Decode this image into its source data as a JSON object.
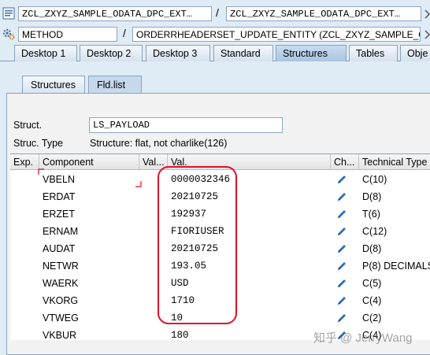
{
  "header": {
    "object_left": "ZCL_ZXYZ_SAMPLE_ODATA_DPC_EXT…",
    "object_right": "ZCL_ZXYZ_SAMPLE_ODATA_DPC_EXT…",
    "type": "METHOD",
    "method": "ORDERRHEADERSET_UPDATE_ENTITY (ZCL_ZXYZ_SAMPLE_O…",
    "separator": "/"
  },
  "tabs": [
    {
      "label": "Desktop 1"
    },
    {
      "label": "Desktop 2"
    },
    {
      "label": "Desktop 3"
    },
    {
      "label": "Standard"
    },
    {
      "label": "Structures"
    },
    {
      "label": "Tables"
    },
    {
      "label": "Obje"
    }
  ],
  "subtabs": [
    {
      "label": "Structures"
    },
    {
      "label": "Fld.list"
    }
  ],
  "struct": {
    "struct_label": "Struct.",
    "struct_value": "LS_PAYLOAD",
    "type_label": "Struc. Type",
    "type_value": "Structure: flat, not charlike(126)"
  },
  "grid": {
    "headers": {
      "exp": "Exp.",
      "component": "Component",
      "val_short": "Val...",
      "val": "Val.",
      "change": "Ch...",
      "tech": "Technical Type"
    },
    "rows": [
      {
        "component": "VBELN",
        "value": "0000032346",
        "tech": "C(10)"
      },
      {
        "component": "ERDAT",
        "value": "20210725",
        "tech": "D(8)"
      },
      {
        "component": "ERZET",
        "value": "192937",
        "tech": "T(6)"
      },
      {
        "component": "ERNAM",
        "value": "FIORIUSER",
        "tech": "C(12)"
      },
      {
        "component": "AUDAT",
        "value": "20210725",
        "tech": "D(8)"
      },
      {
        "component": "NETWR",
        "value": "193.05",
        "tech": "P(8) DECIMALS"
      },
      {
        "component": "WAERK",
        "value": "USD",
        "tech": "C(5)"
      },
      {
        "component": "VKORG",
        "value": "1710",
        "tech": "C(4)"
      },
      {
        "component": "VTWEG",
        "value": "10",
        "tech": "C(2)"
      },
      {
        "component": "VKBUR",
        "value": "180",
        "tech": "C(4)"
      }
    ]
  },
  "watermark": "知乎 @ JerryWang",
  "colors": {
    "accent": "#e0102a",
    "pencil": "#2f6fb4"
  }
}
